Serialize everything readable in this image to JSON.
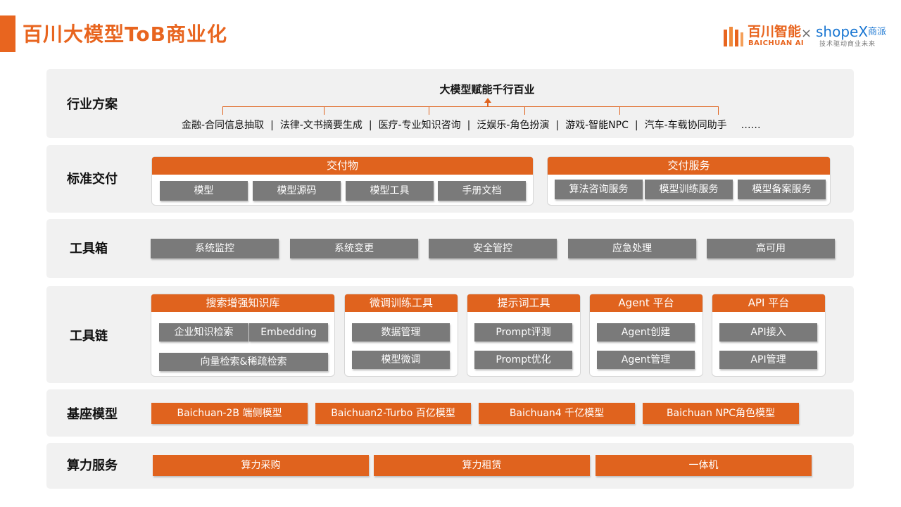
{
  "header": {
    "title": "百川大模型ToB商业化",
    "logo": {
      "baichuan_cn": "百川智能",
      "baichuan_en": "BAICHUAN AI",
      "separator": "×",
      "shopex_word": "shopeX",
      "shopex_cn": "商派",
      "shopex_tagline": "技术驱动商业未来"
    }
  },
  "colors": {
    "accent": "#E8651F",
    "panel": "#f1f1f1",
    "gray_button": "#7a7a7a",
    "shopex_blue": "#1976D2"
  },
  "rows": {
    "industry": {
      "label": "行业方案",
      "headline": "大模型赋能千行百业",
      "items": [
        "金融-合同信息抽取",
        "法律-文书摘要生成",
        "医疗-专业知识咨询",
        "泛娱乐-角色扮演",
        "游戏-智能NPC",
        "汽车-车载协同助手"
      ],
      "separator": "|",
      "ellipsis": "……"
    },
    "delivery": {
      "label": "标准交付",
      "deliverables": {
        "title": "交付物",
        "items": [
          "模型",
          "模型源码",
          "模型工具",
          "手册文档"
        ]
      },
      "services": {
        "title": "交付服务",
        "items": [
          "算法咨询服务",
          "模型训练服务",
          "模型备案服务"
        ]
      }
    },
    "toolbox": {
      "label": "工具箱",
      "items": [
        "系统监控",
        "系统变更",
        "安全管控",
        "应急处理",
        "高可用"
      ]
    },
    "toolchain": {
      "label": "工具链",
      "groups": [
        {
          "title": "搜索增强知识库",
          "items": [
            "企业知识检索",
            "Embedding",
            "向量检索&稀疏检索"
          ]
        },
        {
          "title": "微调训练工具",
          "items": [
            "数据管理",
            "模型微调"
          ]
        },
        {
          "title": "提示词工具",
          "items": [
            "Prompt评测",
            "Prompt优化"
          ]
        },
        {
          "title": "Agent 平台",
          "items": [
            "Agent创建",
            "Agent管理"
          ]
        },
        {
          "title": "API 平台",
          "items": [
            "API接入",
            "API管理"
          ]
        }
      ]
    },
    "base_models": {
      "label": "基座模型",
      "items": [
        "Baichuan-2B 端侧模型",
        "Baichuan2-Turbo 百亿模型",
        "Baichuan4 千亿模型",
        "Baichuan NPC角色模型"
      ]
    },
    "compute": {
      "label": "算力服务",
      "items": [
        "算力采购",
        "算力租赁",
        "一体机"
      ]
    }
  }
}
